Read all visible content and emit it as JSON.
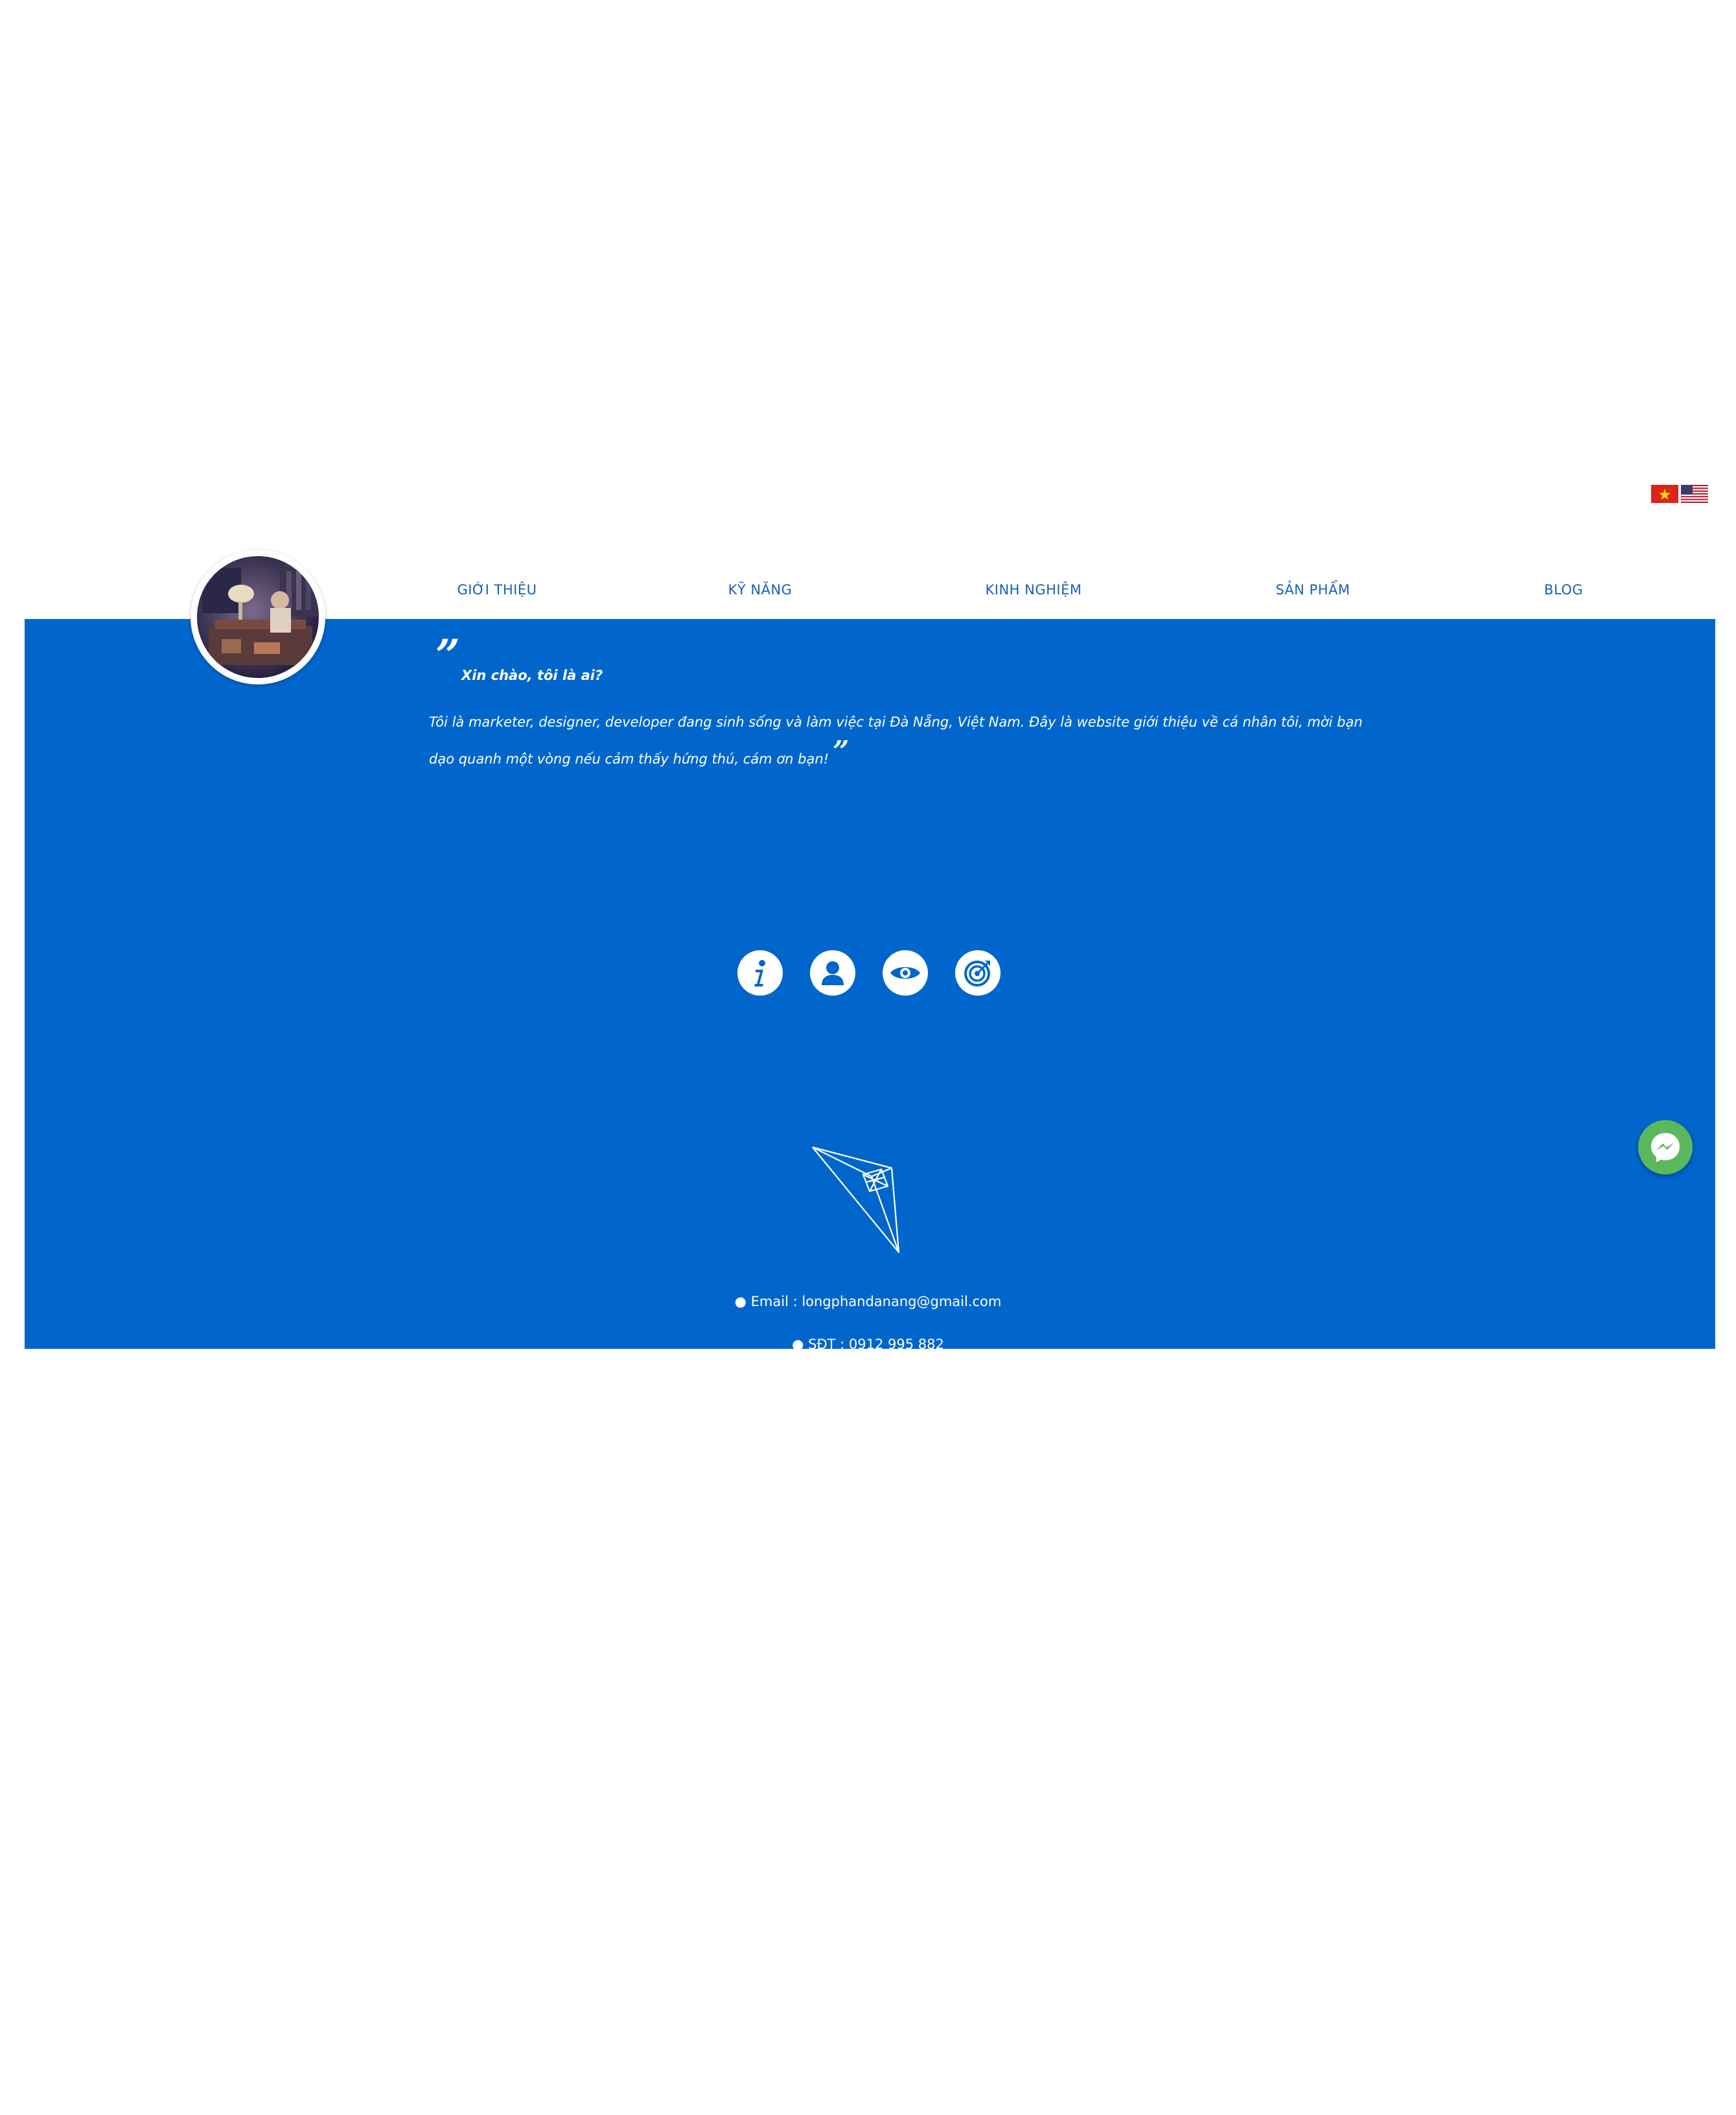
{
  "languages": [
    {
      "name": "vietnamese-flag"
    },
    {
      "name": "us-flag"
    }
  ],
  "nav": {
    "items": [
      {
        "label": "GIỚI THIỆU"
      },
      {
        "label": "KỸ NĂNG"
      },
      {
        "label": "KINH NGHIỆM"
      },
      {
        "label": "SẢN PHẨM"
      },
      {
        "label": "BLOG"
      }
    ]
  },
  "intro": {
    "open_quote": "”",
    "heading": "Xin chào, tôi là ai?",
    "body": "Tôi là marketer, designer, developer đang sinh sống và làm việc tại Đà Nẵng, Việt Nam. Đây là website giới thiệu về cá nhân tôi, mời bạn dạo quanh một vòng nếu cảm thấy hứng thú, cám ơn bạn!",
    "close_quote": "”"
  },
  "icons": [
    "info-icon",
    "user-icon",
    "eye-icon",
    "target-icon"
  ],
  "contact": {
    "email": "● Email : longphandanang@gmail.com",
    "phone": "● SĐT : 0912 995 882"
  },
  "colors": {
    "panel": "#0066cc",
    "nav_text": "#1a5fb8",
    "messenger": "#5cb85c"
  }
}
